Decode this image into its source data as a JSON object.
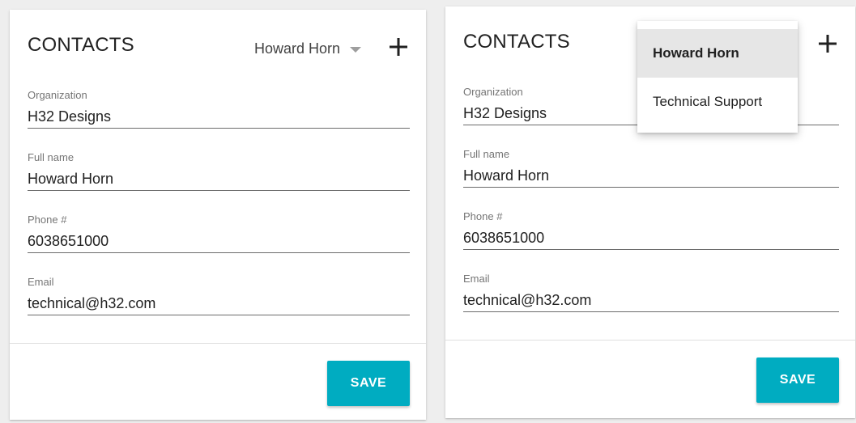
{
  "colors": {
    "accent": "#00acc1",
    "page_background": "#eeeeee",
    "card_background": "#ffffff"
  },
  "left_panel": {
    "title": "CONTACTS",
    "selected_contact": "Howard Horn",
    "add_icon": "plus-icon",
    "fields": {
      "organization": {
        "label": "Organization",
        "value": "H32 Designs"
      },
      "full_name": {
        "label": "Full name",
        "value": "Howard Horn"
      },
      "phone": {
        "label": "Phone #",
        "value": "6038651000"
      },
      "email": {
        "label": "Email",
        "value": "technical@h32.com"
      }
    },
    "save_label": "SAVE"
  },
  "right_panel": {
    "title": "CONTACTS",
    "add_icon": "plus-icon",
    "dropdown": {
      "options": [
        {
          "label": "Howard Horn",
          "selected": true
        },
        {
          "label": "Technical Support",
          "selected": false
        }
      ]
    },
    "fields": {
      "organization": {
        "label": "Organization",
        "value": "H32 Designs"
      },
      "full_name": {
        "label": "Full name",
        "value": "Howard Horn"
      },
      "phone": {
        "label": "Phone #",
        "value": "6038651000"
      },
      "email": {
        "label": "Email",
        "value": "technical@h32.com"
      }
    },
    "save_label": "SAVE"
  }
}
